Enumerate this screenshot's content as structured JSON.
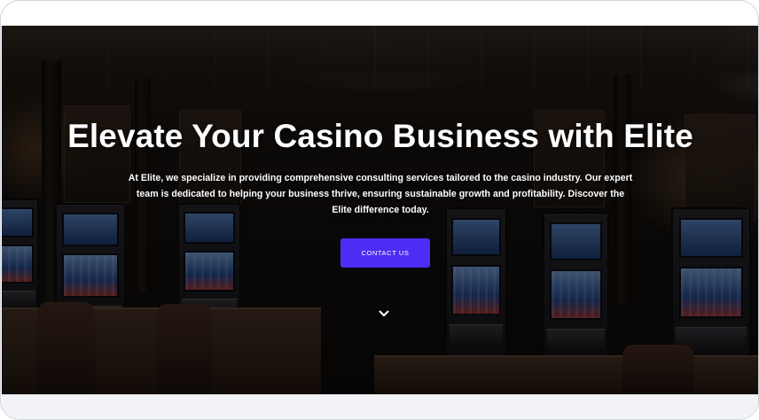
{
  "hero": {
    "title": "Elevate Your Casino Business with Elite",
    "description": "At Elite, we specialize in providing comprehensive consulting services tailored to the casino industry. Our expert team is dedicated to helping your business thrive, ensuring sustainable growth and profitability. Discover the Elite difference today.",
    "cta_label": "CONTACT US",
    "scroll_icon": "chevron-down-icon",
    "background_image": "casino interior with slot machines"
  },
  "colors": {
    "accent": "#4c2df3",
    "title_text": "#ffffff",
    "page_background": "#f1f3f6"
  }
}
